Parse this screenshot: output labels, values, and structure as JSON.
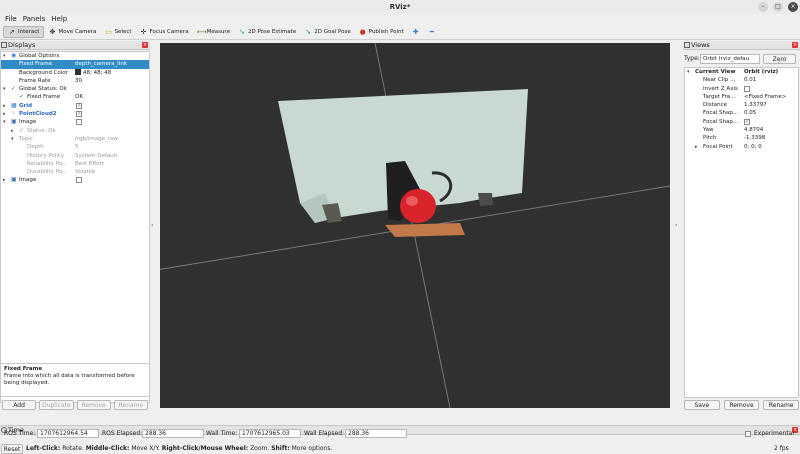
{
  "window": {
    "title": "RViz*"
  },
  "menu": [
    "File",
    "Panels",
    "Help"
  ],
  "toolbar": {
    "tools": [
      {
        "label": "Interact",
        "icon": "interact-icon",
        "active": true
      },
      {
        "label": "Move Camera",
        "icon": "move-camera-icon"
      },
      {
        "label": "Select",
        "icon": "select-icon"
      },
      {
        "label": "Focus Camera",
        "icon": "focus-camera-icon"
      },
      {
        "label": "Measure",
        "icon": "measure-icon"
      },
      {
        "label": "2D Pose Estimate",
        "icon": "pose-estimate-arrow-icon"
      },
      {
        "label": "2D Goal Pose",
        "icon": "goal-pose-arrow-icon"
      },
      {
        "label": "Publish Point",
        "icon": "publish-point-pin-icon"
      }
    ],
    "plus_icon": "add-tool-icon",
    "minus_icon": "remove-tool-icon"
  },
  "displays": {
    "title": "Displays",
    "rows": [
      {
        "label": "Global Options",
        "indent": 1,
        "arrow": "v",
        "icon": "globe-icon",
        "value": ""
      },
      {
        "label": "Fixed Frame",
        "indent": 2,
        "value": "depth_camera_link",
        "selected": true
      },
      {
        "label": "Background Color",
        "indent": 2,
        "value": "48; 48; 48",
        "swatch": "#303030"
      },
      {
        "label": "Frame Rate",
        "indent": 2,
        "value": "30"
      },
      {
        "label": "Global Status: Ok",
        "indent": 1,
        "arrow": "v",
        "check": true,
        "value": ""
      },
      {
        "label": "Fixed Frame",
        "indent": 2,
        "check": true,
        "value": "OK"
      },
      {
        "label": "Grid",
        "indent": 1,
        "arrow": ">",
        "icon": "grid-icon",
        "blue": true,
        "checkbox": "✓"
      },
      {
        "label": "PointCloud2",
        "indent": 1,
        "arrow": ">",
        "icon": "pointcloud-icon",
        "blue": true,
        "checkbox": "✓"
      },
      {
        "label": "Image",
        "indent": 1,
        "arrow": "v",
        "icon": "image-icon",
        "checkbox": " "
      },
      {
        "label": "Status: Ok",
        "indent": 2,
        "arrow": ">",
        "check": true,
        "grey": true,
        "value": ""
      },
      {
        "label": "Topic",
        "indent": 2,
        "arrow": "v",
        "grey": true,
        "value": "/rgb/image_raw"
      },
      {
        "label": "Depth",
        "indent": 3,
        "grey": true,
        "value": "5"
      },
      {
        "label": "History Policy",
        "indent": 3,
        "grey": true,
        "value": "System Default"
      },
      {
        "label": "Reliability Po...",
        "indent": 3,
        "grey": true,
        "value": "Best Effort"
      },
      {
        "label": "Durability Po...",
        "indent": 3,
        "grey": true,
        "value": "Volatile"
      },
      {
        "label": "Image",
        "indent": 1,
        "arrow": ">",
        "icon": "image-icon",
        "checkbox": " "
      }
    ],
    "description_title": "Fixed Frame",
    "description_text": "Frame into which all data is transformed before being displayed.",
    "buttons": [
      "Add",
      "Duplicate",
      "Remove",
      "Rename"
    ]
  },
  "views": {
    "title": "Views",
    "type_label": "Type:",
    "type_value": "Orbit (rviz_defau",
    "zero_label": "Zero",
    "rows": [
      {
        "label": "Current View",
        "value": "Orbit (rviz)",
        "bold": true,
        "arrow": "v"
      },
      {
        "label": "Near Clip ...",
        "value": "0.01"
      },
      {
        "label": "Invert Z Axis",
        "value": "",
        "checkbox": " "
      },
      {
        "label": "Target Fra...",
        "value": "<Fixed Frame>"
      },
      {
        "label": "Distance",
        "value": "1.33797"
      },
      {
        "label": "Focal Shap...",
        "value": "0.05"
      },
      {
        "label": "Focal Shap...",
        "value": "",
        "checkbox": "✓"
      },
      {
        "label": "Yaw",
        "value": "4.8704"
      },
      {
        "label": "Pitch",
        "value": "-1.3398"
      },
      {
        "label": "Focal Point",
        "value": "0; 0; 0",
        "arrow": ">"
      }
    ],
    "buttons": [
      "Save",
      "Remove",
      "Rename"
    ]
  },
  "time": {
    "title": "Time",
    "ros_time_label": "ROS Time:",
    "ros_time": "1707612964.54",
    "ros_elapsed_label": "ROS Elapsed:",
    "ros_elapsed": "288.36",
    "wall_time_label": "Wall Time:",
    "wall_time": "1707612965.03",
    "wall_elapsed_label": "Wall Elapsed:",
    "wall_elapsed": "288.36",
    "experimental_label": "Experimental"
  },
  "status": {
    "reset_label": "Reset",
    "hint_parts": [
      {
        "text": "Left-Click:",
        "bold": true
      },
      {
        "text": " Rotate. "
      },
      {
        "text": "Middle-Click:",
        "bold": true
      },
      {
        "text": " Move X/Y. "
      },
      {
        "text": "Right-Click/Mouse Wheel:",
        "bold": true
      },
      {
        "text": " Zoom. "
      },
      {
        "text": "Shift:",
        "bold": true
      },
      {
        "text": " More options."
      }
    ],
    "fps": "2 fps"
  },
  "viewport": {
    "background": "#303030"
  }
}
